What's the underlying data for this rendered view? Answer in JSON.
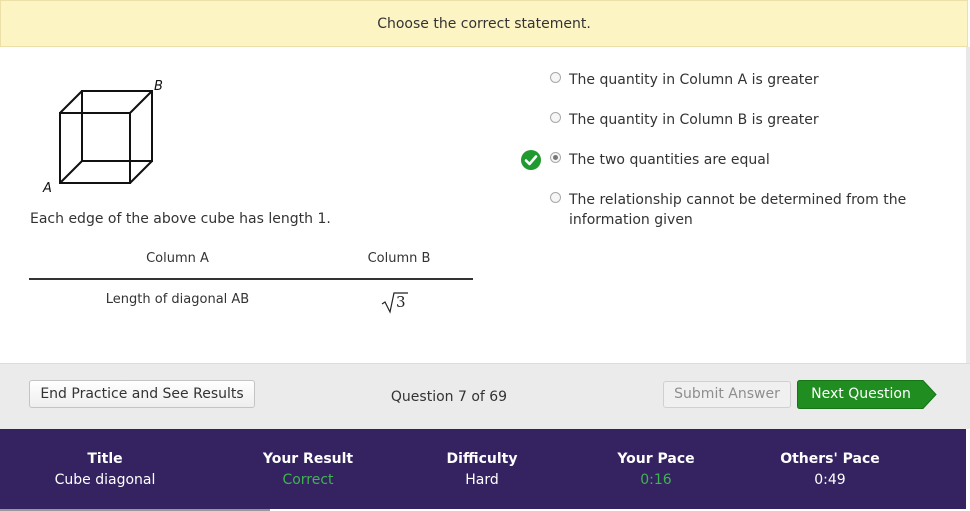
{
  "prompt": "Choose the correct statement.",
  "figure": {
    "vertex_a": "A",
    "vertex_b": "B"
  },
  "description": "Each edge of the above cube has length 1.",
  "comparison": {
    "column_a_header": "Column A",
    "column_b_header": "Column B",
    "column_a_value": "Length of diagonal AB",
    "column_b_value": "3"
  },
  "options": [
    {
      "label": "The quantity in Column A is greater",
      "selected": false
    },
    {
      "label": "The quantity in Column B is greater",
      "selected": false
    },
    {
      "label": "The two quantities are equal",
      "selected": true,
      "marked_correct": true
    },
    {
      "label": "The relationship cannot be determined from the information given",
      "selected": false
    }
  ],
  "actions": {
    "end_practice_label": "End Practice and See Results",
    "question_counter": "Question 7 of 69",
    "submit_label": "Submit Answer",
    "next_label": "Next Question"
  },
  "stats": {
    "title_header": "Title",
    "title_value": "Cube diagonal",
    "result_header": "Your Result",
    "result_value": "Correct",
    "difficulty_header": "Difficulty",
    "difficulty_value": "Hard",
    "pace_header": "Your Pace",
    "pace_value": "0:16",
    "others_header": "Others' Pace",
    "others_value": "0:49"
  },
  "colors": {
    "prompt_background": "#fdf4c4",
    "next_button": "#1f8d1f",
    "stats_background": "#352261",
    "positive_text": "#3fb34f",
    "check_icon": "#1f9a2e"
  },
  "icons": {
    "correct": "check-circle-icon",
    "next_arrow": "arrow-right-icon"
  }
}
